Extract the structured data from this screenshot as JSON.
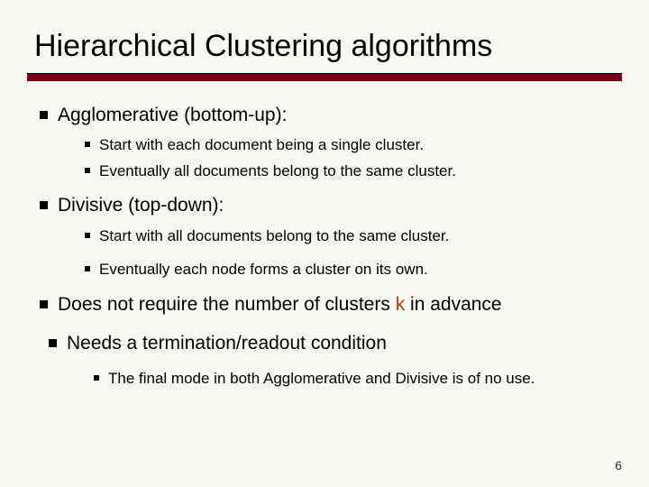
{
  "title": "Hierarchical Clustering algorithms",
  "bullets": [
    {
      "text": "Agglomerative (bottom-up):",
      "sub": [
        "Start with each document being a single cluster.",
        "Eventually all documents belong to the same cluster."
      ]
    },
    {
      "text": "Divisive (top-down):",
      "sub": [
        "Start with all documents belong to the same cluster.",
        "Eventually each node forms a cluster on its own."
      ]
    },
    {
      "text_pre": "Does not require the number of clusters ",
      "k": "k",
      "text_post": " in advance",
      "sub": []
    },
    {
      "text": "Needs a termination/readout condition",
      "sub": [
        "The final mode in both Agglomerative and Divisive is of no use."
      ]
    }
  ],
  "page": "6"
}
